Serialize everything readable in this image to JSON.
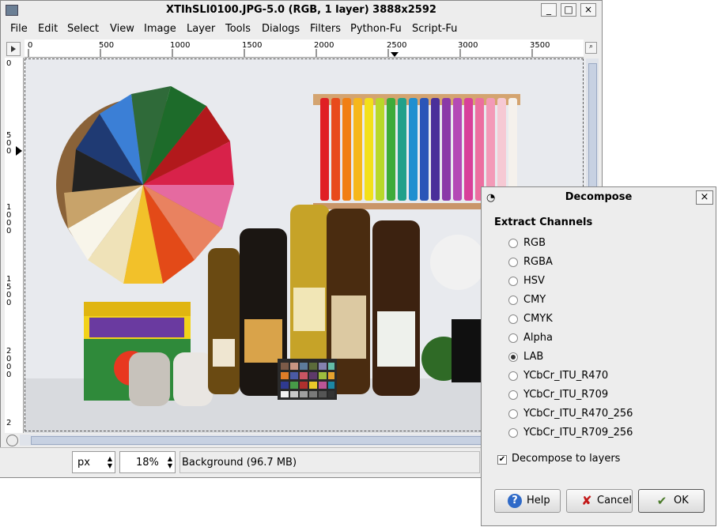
{
  "window": {
    "title": "XTIhSLI0100.JPG-5.0 (RGB, 1 layer) 3888x2592",
    "minimize": "_",
    "maximize": "□",
    "close": "×"
  },
  "menu": [
    {
      "label": "File"
    },
    {
      "label": "Edit"
    },
    {
      "label": "Select"
    },
    {
      "label": "View"
    },
    {
      "label": "Image"
    },
    {
      "label": "Layer"
    },
    {
      "label": "Tools"
    },
    {
      "label": "Dialogs"
    },
    {
      "label": "Filters"
    },
    {
      "label": "Python-Fu"
    },
    {
      "label": "Script-Fu"
    }
  ],
  "ruler": {
    "horizontal": [
      "0",
      "500",
      "1000",
      "1500",
      "2000",
      "2500",
      "3000",
      "3500"
    ],
    "vertical": [
      "0",
      "500",
      "1000",
      "1500",
      "2000",
      "2"
    ]
  },
  "status": {
    "unit": "px",
    "zoom": "18%",
    "message": "Background (96.7 MB)"
  },
  "dialog": {
    "title": "Decompose",
    "close": "×",
    "heading": "Extract Channels",
    "options": [
      {
        "label": "RGB",
        "checked": false
      },
      {
        "label": "RGBA",
        "checked": false
      },
      {
        "label": "HSV",
        "checked": false
      },
      {
        "label": "CMY",
        "checked": false
      },
      {
        "label": "CMYK",
        "checked": false
      },
      {
        "label": "Alpha",
        "checked": false
      },
      {
        "label": "LAB",
        "checked": true
      },
      {
        "label": "YCbCr_ITU_R470",
        "checked": false
      },
      {
        "label": "YCbCr_ITU_R709",
        "checked": false
      },
      {
        "label": "YCbCr_ITU_R470_256",
        "checked": false
      },
      {
        "label": "YCbCr_ITU_R709_256",
        "checked": false
      }
    ],
    "decompose_to_layers": {
      "label": "Decompose to layers",
      "checked": true
    },
    "buttons": {
      "help": "Help",
      "cancel": "Cancel",
      "ok": "OK"
    }
  },
  "icons": {
    "ruler_corner": "navigate-icon",
    "zoom_corner": "zoom-icon",
    "dialog": "decompose-icon",
    "help": "help-icon",
    "cancel": "cancel-icon",
    "ok": "ok-icon"
  }
}
